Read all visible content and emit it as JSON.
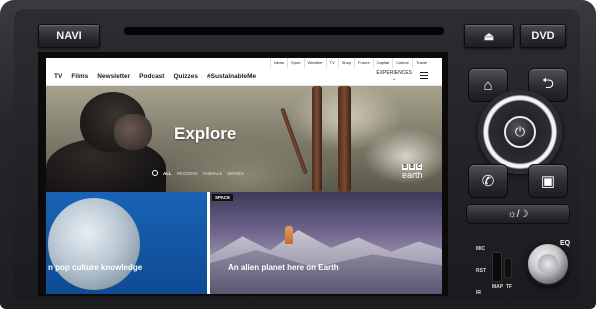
{
  "hardware": {
    "navi_label": "NAVI",
    "eject_icon": "⏏",
    "dvd_label": "DVD",
    "home_icon": "⌂",
    "back_icon": "⮌",
    "power_icon": "⏻",
    "phone_icon": "✆",
    "radio_icon": "▣",
    "brightness_label": "☼/☽",
    "mic_label": "MIC",
    "rst_label": "RST",
    "ir_label": "IR",
    "map_label": "MAP",
    "tf_label": "TF",
    "eq_label": "EQ"
  },
  "browser": {
    "top_links": [
      "News",
      "Sport",
      "Weather",
      "TV",
      "Shop",
      "Future",
      "Capital",
      "Culture",
      "Travel"
    ],
    "main_nav": [
      "TV",
      "Films",
      "Newsletter",
      "Podcast",
      "Quizzes",
      "#SustainableMe"
    ],
    "experiences_label": "EXPERIENCES",
    "hero": {
      "title": "Explore",
      "filter_all": "ALL",
      "filter_items": [
        "REGIONS",
        "ANIMALS",
        "SERIES"
      ],
      "logo_blocks": [
        "B",
        "B",
        "C"
      ],
      "logo_word": "earth"
    },
    "cards": [
      {
        "title": "n pop culture knowledge",
        "tag": ""
      },
      {
        "title": "An alien planet here on Earth",
        "tag": "SPACE"
      }
    ]
  }
}
